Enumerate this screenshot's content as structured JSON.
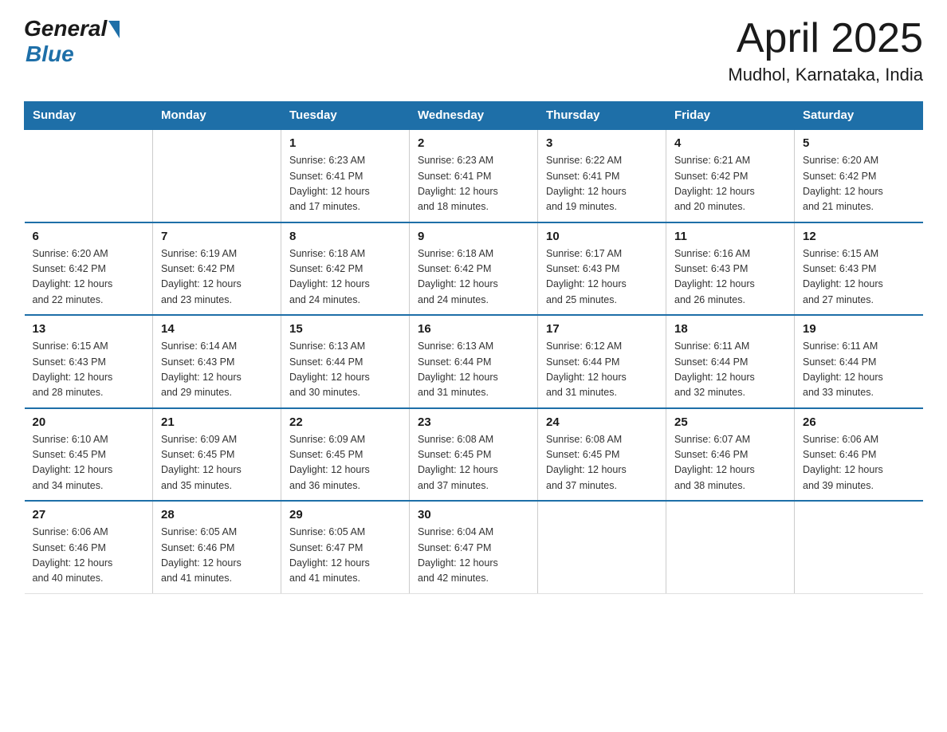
{
  "header": {
    "logo_general": "General",
    "logo_blue": "Blue",
    "title": "April 2025",
    "subtitle": "Mudhol, Karnataka, India"
  },
  "days_of_week": [
    "Sunday",
    "Monday",
    "Tuesday",
    "Wednesday",
    "Thursday",
    "Friday",
    "Saturday"
  ],
  "weeks": [
    [
      {
        "num": "",
        "info": ""
      },
      {
        "num": "",
        "info": ""
      },
      {
        "num": "1",
        "info": "Sunrise: 6:23 AM\nSunset: 6:41 PM\nDaylight: 12 hours\nand 17 minutes."
      },
      {
        "num": "2",
        "info": "Sunrise: 6:23 AM\nSunset: 6:41 PM\nDaylight: 12 hours\nand 18 minutes."
      },
      {
        "num": "3",
        "info": "Sunrise: 6:22 AM\nSunset: 6:41 PM\nDaylight: 12 hours\nand 19 minutes."
      },
      {
        "num": "4",
        "info": "Sunrise: 6:21 AM\nSunset: 6:42 PM\nDaylight: 12 hours\nand 20 minutes."
      },
      {
        "num": "5",
        "info": "Sunrise: 6:20 AM\nSunset: 6:42 PM\nDaylight: 12 hours\nand 21 minutes."
      }
    ],
    [
      {
        "num": "6",
        "info": "Sunrise: 6:20 AM\nSunset: 6:42 PM\nDaylight: 12 hours\nand 22 minutes."
      },
      {
        "num": "7",
        "info": "Sunrise: 6:19 AM\nSunset: 6:42 PM\nDaylight: 12 hours\nand 23 minutes."
      },
      {
        "num": "8",
        "info": "Sunrise: 6:18 AM\nSunset: 6:42 PM\nDaylight: 12 hours\nand 24 minutes."
      },
      {
        "num": "9",
        "info": "Sunrise: 6:18 AM\nSunset: 6:42 PM\nDaylight: 12 hours\nand 24 minutes."
      },
      {
        "num": "10",
        "info": "Sunrise: 6:17 AM\nSunset: 6:43 PM\nDaylight: 12 hours\nand 25 minutes."
      },
      {
        "num": "11",
        "info": "Sunrise: 6:16 AM\nSunset: 6:43 PM\nDaylight: 12 hours\nand 26 minutes."
      },
      {
        "num": "12",
        "info": "Sunrise: 6:15 AM\nSunset: 6:43 PM\nDaylight: 12 hours\nand 27 minutes."
      }
    ],
    [
      {
        "num": "13",
        "info": "Sunrise: 6:15 AM\nSunset: 6:43 PM\nDaylight: 12 hours\nand 28 minutes."
      },
      {
        "num": "14",
        "info": "Sunrise: 6:14 AM\nSunset: 6:43 PM\nDaylight: 12 hours\nand 29 minutes."
      },
      {
        "num": "15",
        "info": "Sunrise: 6:13 AM\nSunset: 6:44 PM\nDaylight: 12 hours\nand 30 minutes."
      },
      {
        "num": "16",
        "info": "Sunrise: 6:13 AM\nSunset: 6:44 PM\nDaylight: 12 hours\nand 31 minutes."
      },
      {
        "num": "17",
        "info": "Sunrise: 6:12 AM\nSunset: 6:44 PM\nDaylight: 12 hours\nand 31 minutes."
      },
      {
        "num": "18",
        "info": "Sunrise: 6:11 AM\nSunset: 6:44 PM\nDaylight: 12 hours\nand 32 minutes."
      },
      {
        "num": "19",
        "info": "Sunrise: 6:11 AM\nSunset: 6:44 PM\nDaylight: 12 hours\nand 33 minutes."
      }
    ],
    [
      {
        "num": "20",
        "info": "Sunrise: 6:10 AM\nSunset: 6:45 PM\nDaylight: 12 hours\nand 34 minutes."
      },
      {
        "num": "21",
        "info": "Sunrise: 6:09 AM\nSunset: 6:45 PM\nDaylight: 12 hours\nand 35 minutes."
      },
      {
        "num": "22",
        "info": "Sunrise: 6:09 AM\nSunset: 6:45 PM\nDaylight: 12 hours\nand 36 minutes."
      },
      {
        "num": "23",
        "info": "Sunrise: 6:08 AM\nSunset: 6:45 PM\nDaylight: 12 hours\nand 37 minutes."
      },
      {
        "num": "24",
        "info": "Sunrise: 6:08 AM\nSunset: 6:45 PM\nDaylight: 12 hours\nand 37 minutes."
      },
      {
        "num": "25",
        "info": "Sunrise: 6:07 AM\nSunset: 6:46 PM\nDaylight: 12 hours\nand 38 minutes."
      },
      {
        "num": "26",
        "info": "Sunrise: 6:06 AM\nSunset: 6:46 PM\nDaylight: 12 hours\nand 39 minutes."
      }
    ],
    [
      {
        "num": "27",
        "info": "Sunrise: 6:06 AM\nSunset: 6:46 PM\nDaylight: 12 hours\nand 40 minutes."
      },
      {
        "num": "28",
        "info": "Sunrise: 6:05 AM\nSunset: 6:46 PM\nDaylight: 12 hours\nand 41 minutes."
      },
      {
        "num": "29",
        "info": "Sunrise: 6:05 AM\nSunset: 6:47 PM\nDaylight: 12 hours\nand 41 minutes."
      },
      {
        "num": "30",
        "info": "Sunrise: 6:04 AM\nSunset: 6:47 PM\nDaylight: 12 hours\nand 42 minutes."
      },
      {
        "num": "",
        "info": ""
      },
      {
        "num": "",
        "info": ""
      },
      {
        "num": "",
        "info": ""
      }
    ]
  ]
}
